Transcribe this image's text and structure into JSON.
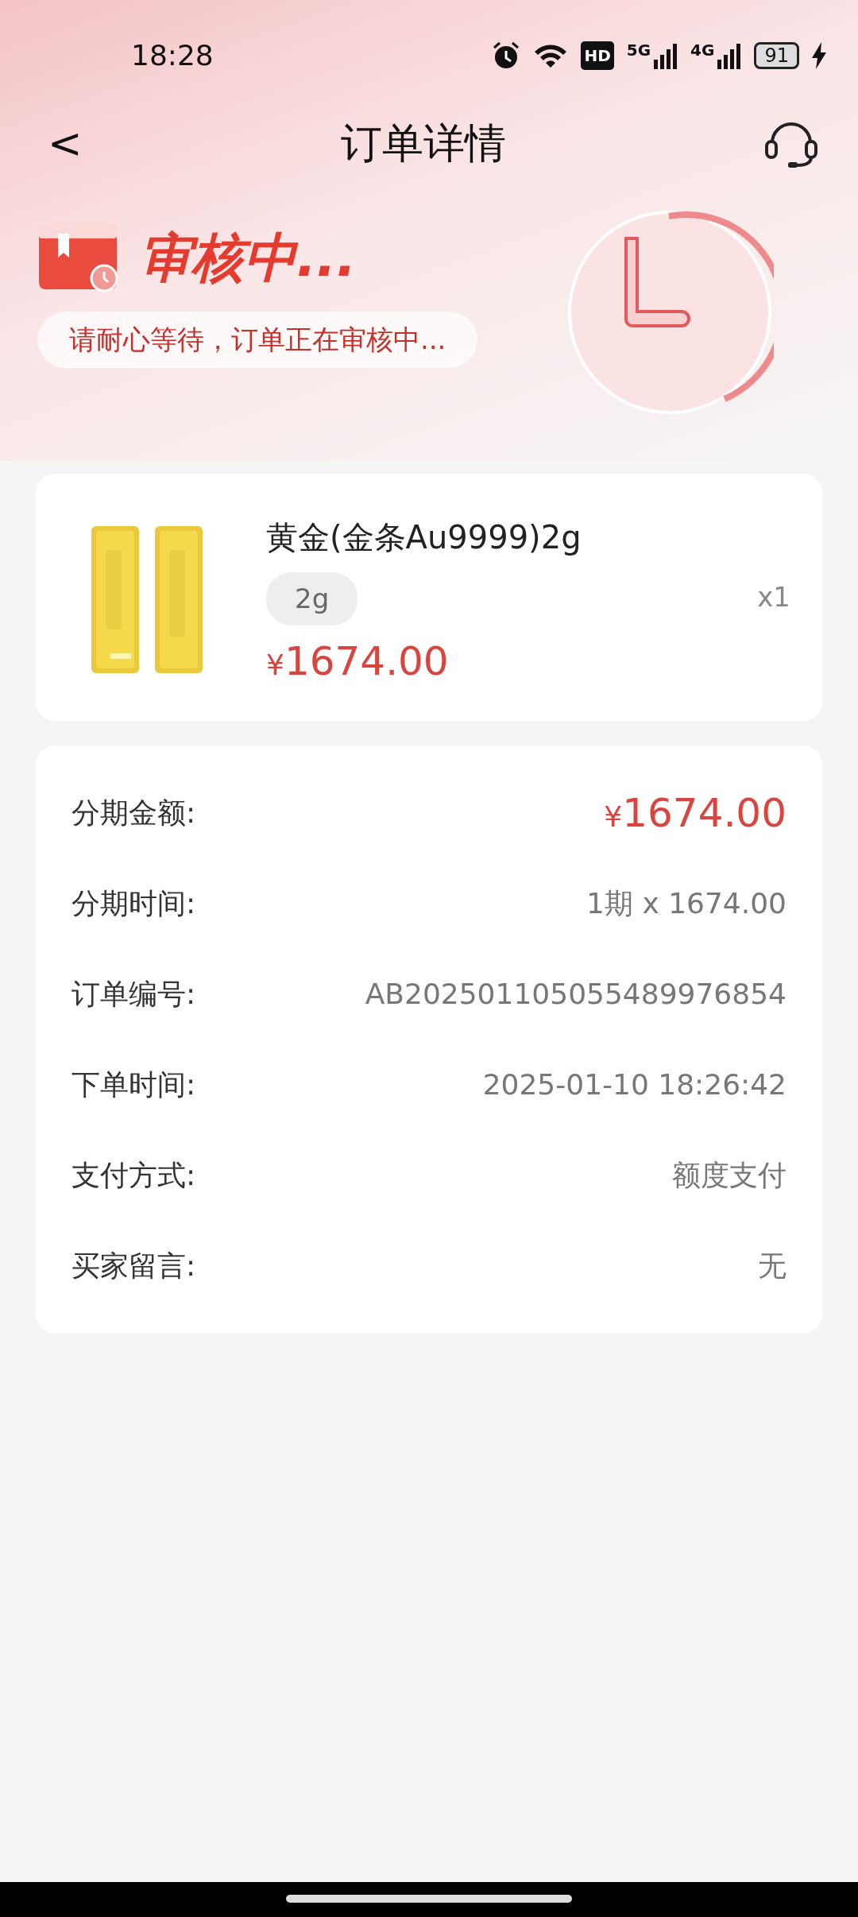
{
  "status_bar": {
    "time": "18:28",
    "hd_label": "HD",
    "networks": [
      "5G",
      "4G"
    ],
    "battery": "91",
    "charging": true
  },
  "nav": {
    "back": "<",
    "title": "订单详情"
  },
  "status": {
    "title": "审核中...",
    "message": "请耐心等待，订单正在审核中..."
  },
  "product": {
    "name": "黄金(金条Au9999)2g",
    "spec": "2g",
    "quantity": "x1",
    "currency": "¥",
    "price": "1674.00"
  },
  "details": [
    {
      "label": "分期金额:",
      "kind": "price",
      "currency": "¥",
      "value": "1674.00"
    },
    {
      "label": "分期时间:",
      "kind": "text",
      "value": "1期 x 1674.00"
    },
    {
      "label": "订单编号:",
      "kind": "text",
      "value": "AB202501105055489976854"
    },
    {
      "label": "下单时间:",
      "kind": "text",
      "value": "2025-01-10 18:26:42"
    },
    {
      "label": "支付方式:",
      "kind": "text",
      "value": "额度支付"
    },
    {
      "label": "买家留言:",
      "kind": "text",
      "value": "无"
    }
  ]
}
